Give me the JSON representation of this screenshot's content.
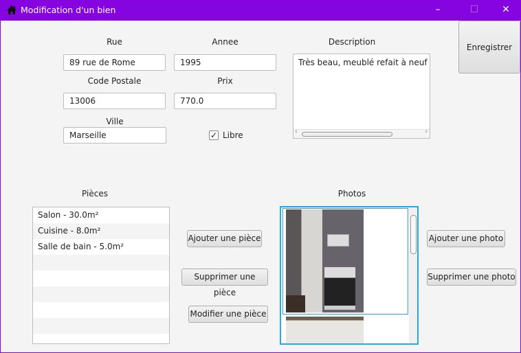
{
  "window": {
    "title": "Modification d'un bien",
    "icon": "house-icon",
    "accent": "#8504e0"
  },
  "form": {
    "rue": {
      "label": "Rue",
      "value": "89 rue de Rome"
    },
    "annee": {
      "label": "Annee",
      "value": "1995"
    },
    "code_postale": {
      "label": "Code Postale",
      "value": "13006"
    },
    "prix": {
      "label": "Prix",
      "value": "770.0"
    },
    "ville": {
      "label": "Ville",
      "value": "Marseille"
    },
    "libre": {
      "label": "Libre",
      "checked": true
    },
    "description": {
      "label": "Description",
      "value": "Très beau, meublé refait à neuf près"
    }
  },
  "save_label": "Enregistrer",
  "pieces": {
    "label": "Pièces",
    "items": [
      "Salon - 30.0m²",
      "Cuisine - 8.0m²",
      "Salle de bain - 5.0m²"
    ],
    "add": "Ajouter une pièce",
    "remove": "Supprimer une pièce",
    "edit": "Modifier une pièce"
  },
  "photos": {
    "label": "Photos",
    "add": "Ajouter une photo",
    "remove": "Supprimer une photo",
    "selected_index": 0
  }
}
